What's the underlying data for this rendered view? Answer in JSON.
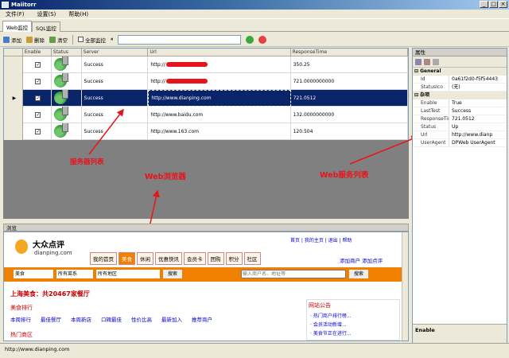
{
  "window": {
    "title": "Maiitorr"
  },
  "menu": [
    "文件(F)",
    "设置(S)",
    "帮助(H)"
  ],
  "tabs": [
    {
      "label": "Web监控"
    },
    {
      "label": "SQL监控"
    }
  ],
  "toolbar": {
    "add": "添加",
    "delete": "删除",
    "clear": "清空",
    "all_check_label": "全部监控",
    "url_value": ""
  },
  "grid": {
    "columns": [
      "Enable",
      "Status",
      "Server",
      "Url",
      "ResponseTime"
    ],
    "rows": [
      {
        "status": "Success",
        "url": "http://",
        "redacted": true,
        "response": "350.25"
      },
      {
        "status": "Success",
        "url": "http://",
        "redacted": true,
        "response": "721.0000000000"
      },
      {
        "status": "Success",
        "url": "http://www.dianping.com",
        "redacted": false,
        "response": "721.0512"
      },
      {
        "status": "Success",
        "url": "http://www.baidu.com",
        "redacted": false,
        "response": "132.0000000000"
      },
      {
        "status": "Success",
        "url": "http://www.163.com",
        "redacted": false,
        "response": "120.504"
      }
    ]
  },
  "props": {
    "header": "属性",
    "general_label": "General",
    "general": [
      {
        "k": "Id",
        "v": "0a61f2d0-f5f54443"
      },
      {
        "k": "StatusIco",
        "v": "(无)"
      }
    ],
    "other_label": "杂项",
    "other": [
      {
        "k": "Enable",
        "v": "True"
      },
      {
        "k": "LastTest",
        "v": "Success"
      },
      {
        "k": "ResponseTime",
        "v": "721.0512"
      },
      {
        "k": "Status",
        "v": "Up"
      },
      {
        "k": "Url",
        "v": "http://www.dianp"
      },
      {
        "k": "UserAgent",
        "v": "DPWeb UserAgent"
      }
    ],
    "desc": "Enable"
  },
  "browser": {
    "header": "浏览",
    "site_name": "大众点评",
    "site_domain": "dianping.com",
    "city_title": "上海美食：共20467家餐厅",
    "nav": [
      "我的首页",
      "美食",
      "休闲",
      "优惠快讯",
      "会员卡",
      "团购",
      "积分",
      "社区"
    ],
    "top_links": "首页 | 我的主页 | 退出 | 帮助",
    "add_shop": "添加商户",
    "add_review": "添加点评",
    "search_placeholder": "输入商户名、地址等",
    "search_button": "搜索",
    "select1": "美食",
    "select2": "所有菜系",
    "select3": "所有地区",
    "section1": "美食排行",
    "section2": "网站公告",
    "section3": "热门商区",
    "notice1": "· 热门商户排行榜...",
    "notice2": "· 会员活动新增...",
    "notice3": "· 美食节正在进行...",
    "ranks": [
      "本周排行",
      "最佳餐厅",
      "本周新店",
      "口碑最佳",
      "性价比高",
      "最新加入",
      "推荐商户"
    ]
  },
  "annotations": {
    "server_list": "服务器列表",
    "web_browser": "Web浏览器",
    "web_server_list": "Web服务列表"
  },
  "statusbar": {
    "text": "http://www.dianping.com"
  }
}
